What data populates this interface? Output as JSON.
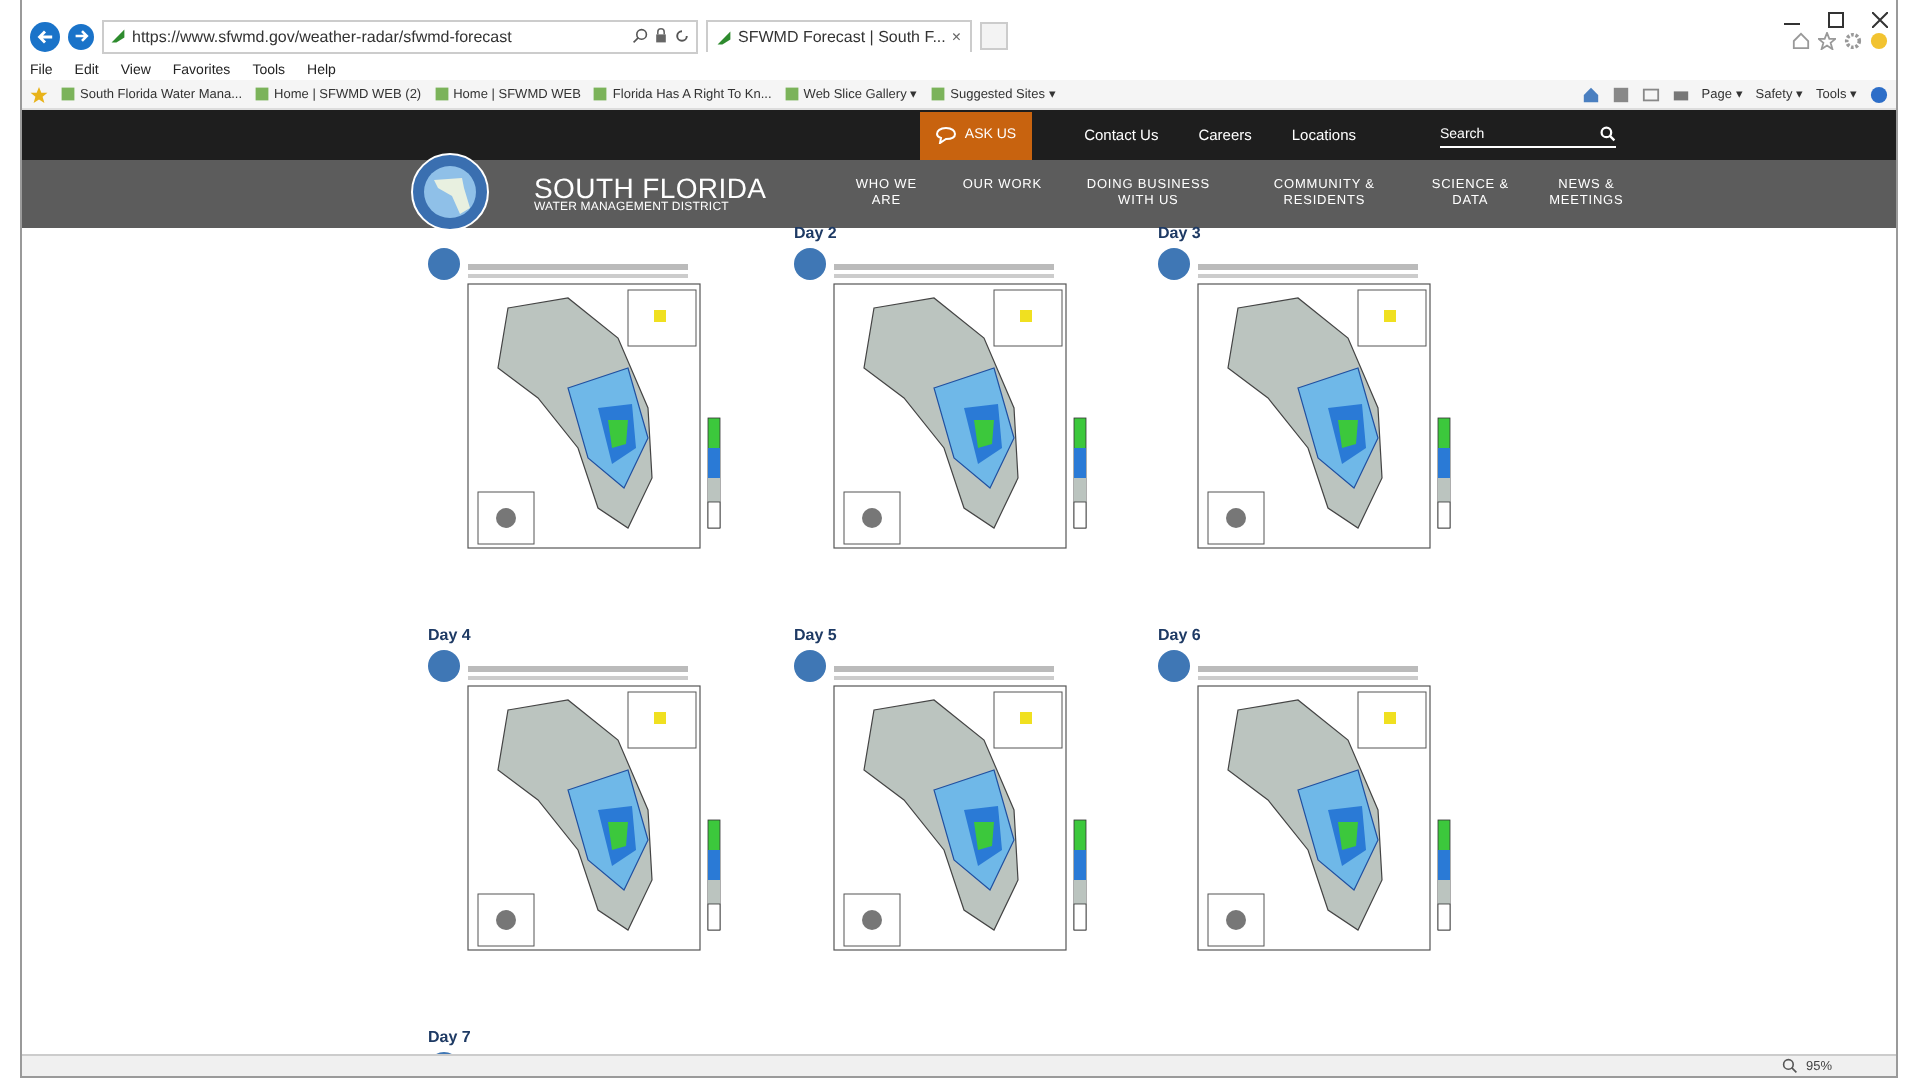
{
  "browser": {
    "address": "https://www.sfwmd.gov/weather-radar/sfwmd-forecast",
    "tab": {
      "title": "SFWMD Forecast | South F...",
      "close": "×"
    },
    "menu": [
      "File",
      "Edit",
      "View",
      "Favorites",
      "Tools",
      "Help"
    ],
    "favorites": [
      {
        "label": "South Florida Water Mana..."
      },
      {
        "label": "Home | SFWMD WEB (2)"
      },
      {
        "label": "Home | SFWMD WEB"
      },
      {
        "label": "Florida Has A Right To Kn..."
      },
      {
        "label": "Web Slice Gallery ▾"
      },
      {
        "label": "Suggested Sites ▾"
      }
    ],
    "commands": [
      "Page ▾",
      "Safety ▾",
      "Tools ▾"
    ],
    "zoom": "95%"
  },
  "site": {
    "ask": "ASK US",
    "links": [
      "Contact Us",
      "Careers",
      "Locations"
    ],
    "search": {
      "placeholder": "Search"
    },
    "brand": "SOUTH FLORIDA",
    "brand_sub": "WATER MANAGEMENT DISTRICT",
    "nav": [
      "WHO WE ARE",
      "OUR WORK",
      "DOING BUSINESS WITH US",
      "COMMUNITY & RESIDENTS",
      "SCIENCE & DATA",
      "NEWS & MEETINGS"
    ]
  },
  "unlabeled_first_map": true,
  "forecasts": [
    {
      "label": "Day 2"
    },
    {
      "label": "Day 3"
    },
    {
      "label": "Day 4"
    },
    {
      "label": "Day 5"
    },
    {
      "label": "Day 6"
    },
    {
      "label": "Day 7"
    }
  ]
}
